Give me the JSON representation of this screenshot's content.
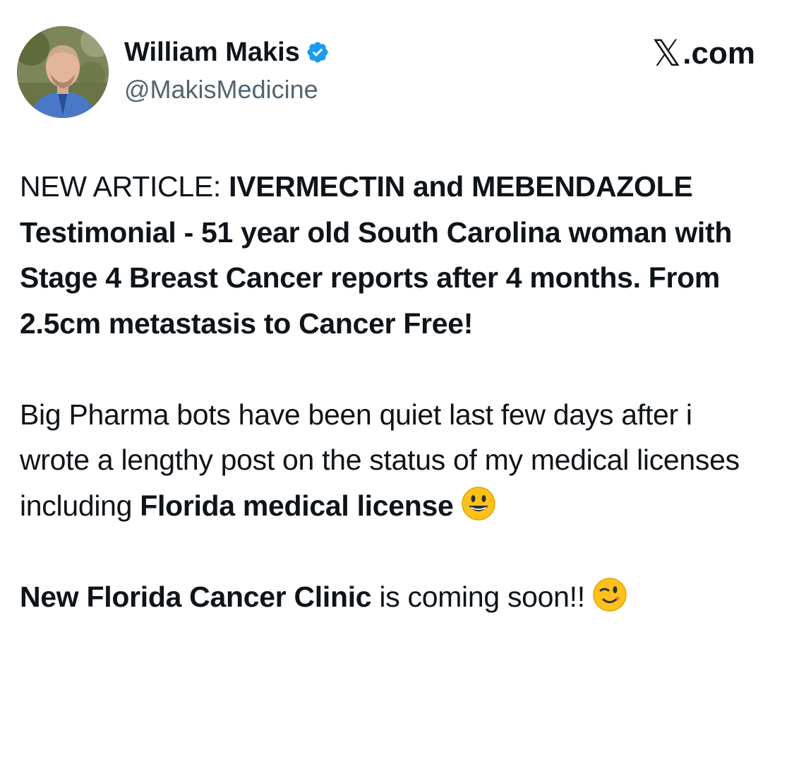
{
  "post": {
    "author_name": "William Makis",
    "handle": "@MakisMedicine",
    "verified": true,
    "site_logo_mark": "𝕏",
    "site_logo_text": ".com",
    "p1_lead": "NEW ARTICLE: ",
    "p1_bold": "IVERMECTIN and MEBENDAZOLE Testimonial - 51 year old South Carolina woman with Stage 4 Breast Cancer reports after 4 months. From 2.5cm metastasis to Cancer Free!",
    "p2_text": "Big Pharma bots have been quiet last few days after i wrote a lengthy post on the status of my medical licenses including ",
    "p2_bold": "Florida medical license",
    "p2_emoji": "smiley-face-icon",
    "p3_bold": "New Florida Cancer Clinic",
    "p3_text": " is coming soon!!",
    "p3_emoji": "winking-face-icon"
  },
  "colors": {
    "text": "#0f1419",
    "muted": "#536471",
    "verified_badge": "#1d9bf0",
    "emoji_yellow": "#fcc21b"
  }
}
